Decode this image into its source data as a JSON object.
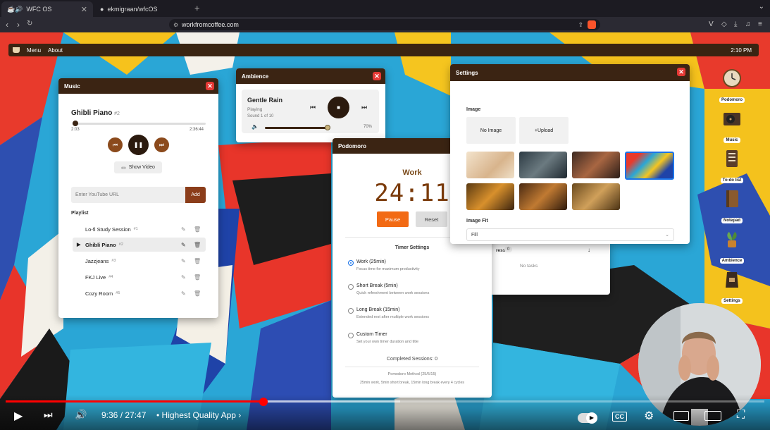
{
  "browser": {
    "tabs": [
      {
        "label": "WFC OS",
        "active": true
      },
      {
        "label": "ekmigraan/wfcOS",
        "active": false
      }
    ],
    "url": "workfromcoffee.com"
  },
  "os": {
    "menu": "Menu",
    "about": "About",
    "clock": "2:10 PM"
  },
  "music": {
    "title": "Music",
    "song": "Ghibli Piano",
    "song_num": "#2",
    "time_current": "2:03",
    "time_total": "2:36:44",
    "progress": 0.02,
    "show_video": "Show Video",
    "yt_placeholder": "Enter YouTube URL",
    "add": "Add",
    "playlist_label": "Playlist",
    "playlist": [
      {
        "name": "Lo-fi Study Session",
        "num": "#1",
        "current": false
      },
      {
        "name": "Ghibli Piano",
        "num": "#2",
        "current": true
      },
      {
        "name": "Jazzjeans",
        "num": "#3",
        "current": false
      },
      {
        "name": "FKJ Live",
        "num": "#4",
        "current": false
      },
      {
        "name": "Cozy Room",
        "num": "#5",
        "current": false
      }
    ]
  },
  "ambience": {
    "title": "Ambience",
    "sound": "Gentle Rain",
    "status": "Playing",
    "counter": "Sound 1 of 10",
    "volume_label": "70%",
    "volume": 0.7
  },
  "podomoro": {
    "title": "Podomoro",
    "mode": "Work",
    "timer": "24:11",
    "pause": "Pause",
    "reset": "Reset",
    "settings_title": "Timer Settings",
    "options": [
      {
        "title": "Work (25min)",
        "desc": "Focus time for maximum productivity",
        "selected": true
      },
      {
        "title": "Short Break (5min)",
        "desc": "Quick refreshment between work sessions",
        "selected": false
      },
      {
        "title": "Long Break (15min)",
        "desc": "Extended rest after multiple work sessions",
        "selected": false
      },
      {
        "title": "Custom Timer",
        "desc": "Set your own timer duration and title",
        "selected": false
      }
    ],
    "completed": "Completed Sessions: 0",
    "method_title": "Pomodoro Method (25/5/15)",
    "method_desc": "25min work, 5min short break, 15min long break every 4 cycles"
  },
  "todo": {
    "progress_label": "ress",
    "count": "0",
    "empty": "No tasks"
  },
  "settings": {
    "title": "Settings",
    "image_label": "Image",
    "no_image": "No Image",
    "upload": "+Upload",
    "fit_label": "Image Fit",
    "fit_value": "Fill",
    "thumbs": [
      "sketch-cafe",
      "dark-cafe",
      "shop-front",
      "abstract-wall",
      "warm-bar",
      "cozy-lounge",
      "night-cafe"
    ],
    "selected_thumb": 3
  },
  "desktop_icons": [
    {
      "label": "Podomoro",
      "icon": "clock-icon"
    },
    {
      "label": "Music",
      "icon": "turntable-icon"
    },
    {
      "label": "To-do list",
      "icon": "notepad-list-icon"
    },
    {
      "label": "Notepad",
      "icon": "book-icon"
    },
    {
      "label": "Ambience",
      "icon": "plant-icon"
    },
    {
      "label": "Settings",
      "icon": "coffee-bag-icon"
    }
  ],
  "video": {
    "time": "9:36 / 27:47",
    "chapter": "• Highest Quality App",
    "progress": 0.34,
    "buffered": 0.52
  }
}
